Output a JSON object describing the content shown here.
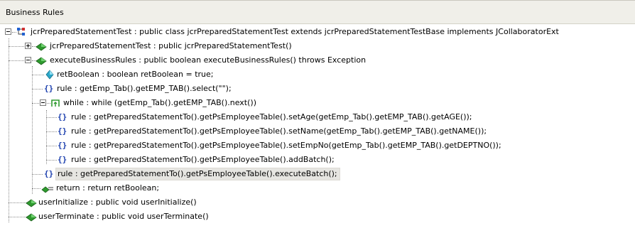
{
  "panel": {
    "title": "Business Rules"
  },
  "tree": {
    "root_label": "jcrPreparedStatementTest : public class jcrPreparedStatementTest extends jcrPreparedStatementTestBase implements JCollaboratorExt",
    "constructor_label": "jcrPreparedStatementTest : public  jcrPreparedStatementTest()",
    "method_label": "executeBusinessRules : public boolean executeBusinessRules() throws Exception",
    "var_label": "retBoolean : boolean retBoolean = true;",
    "rule1_label": "rule : getEmp_Tab().getEMP_TAB().select(\"\");",
    "while_label": "while : while (getEmp_Tab().getEMP_TAB().next())",
    "rule_setage_label": "rule : getPreparedStatementTo().getPsEmployeeTable().setAge(getEmp_Tab().getEMP_TAB().getAGE());",
    "rule_setname_label": "rule : getPreparedStatementTo().getPsEmployeeTable().setName(getEmp_Tab().getEMP_TAB().getNAME());",
    "rule_setempno_label": "rule : getPreparedStatementTo().getPsEmployeeTable().setEmpNo(getEmp_Tab().getEMP_TAB().getDEPTNO());",
    "rule_addbatch_label": "rule : getPreparedStatementTo().getPsEmployeeTable().addBatch();",
    "rule_execbatch_label": "rule : getPreparedStatementTo().getPsEmployeeTable().executeBatch();",
    "return_label": "return : return retBoolean;",
    "userinit_label": "userInitialize : public void userInitialize()",
    "userterm_label": "userTerminate : public void userTerminate()",
    "braces_glyph": "{}"
  },
  "colors": {
    "header_bg": "#f0efe9",
    "selection_bg": "#e6e5e1",
    "method_green": "#2e9a2e",
    "rule_blue": "#1c3fae",
    "var_teal": "#2aa7c9",
    "class_blue": "#3b6fd6"
  },
  "icons": {
    "class": "class-icon",
    "method": "method-icon",
    "variable": "variable-icon",
    "rule": "rule-braces-icon",
    "while": "while-loop-icon",
    "return": "return-icon"
  }
}
